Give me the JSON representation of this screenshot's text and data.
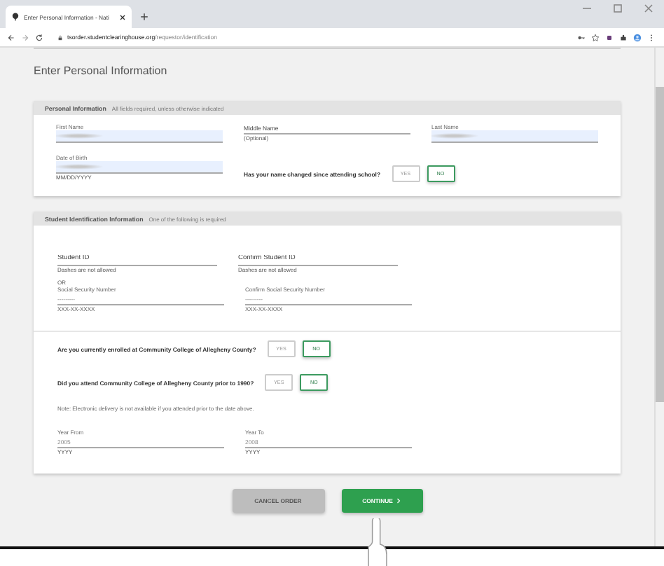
{
  "browser": {
    "tab_title": "Enter Personal Information - Nati",
    "url_host": "tsorder.studentclearinghouse.org",
    "url_path": "/requestor/identification"
  },
  "page_title": "Enter Personal Information",
  "personal": {
    "title": "Personal Information",
    "subtitle": "All fields required, unless otherwise indicated",
    "fields": [
      {
        "label": "First Name",
        "redacted": true
      },
      {
        "placeholder": "Middle Name",
        "hint": "(Optional)"
      },
      {
        "label": "Last Name",
        "redacted": true
      }
    ],
    "dob": {
      "label": "Date of Birth",
      "redacted": true,
      "hint": "MM/DD/YYYY"
    },
    "question": {
      "text": "Has your name changed since attending school?",
      "options": [
        {
          "label": "YES",
          "selected": false
        },
        {
          "label": "NO",
          "selected": true
        }
      ]
    }
  },
  "student": {
    "title": "Student Identification Information",
    "subtitle": "One of the following is required",
    "id_fields": [
      {
        "placeholder": "Student ID",
        "hint": "Dashes are not allowed"
      },
      {
        "placeholder": "Confirm Student ID",
        "hint": "Dashes are not allowed"
      }
    ],
    "or_text": "OR",
    "ssn_fields": [
      {
        "label": "Social Security Number",
        "value": "---------",
        "hint": "XXX-XX-XXXX"
      },
      {
        "label": "Confirm Social Security Number",
        "value": "---------",
        "hint": "XXX-XX-XXXX"
      }
    ],
    "questions": [
      {
        "text": "Are you currently enrolled at Community College of Allegheny County?",
        "options": [
          {
            "label": "YES",
            "selected": false
          },
          {
            "label": "NO",
            "selected": true
          }
        ]
      },
      {
        "text": "Did you attend Community College of Allegheny County prior to 1990?",
        "options": [
          {
            "label": "YES",
            "selected": false
          },
          {
            "label": "NO",
            "selected": true
          }
        ]
      }
    ],
    "note": "Note: Electronic delivery is not available if you attended prior to the date above.",
    "year_fields": [
      {
        "label": "Year From",
        "value": "2005",
        "hint": "YYYY"
      },
      {
        "label": "Year To",
        "value": "2008",
        "hint": "YYYY"
      }
    ]
  },
  "buttons": [
    {
      "label": "CANCEL ORDER",
      "kind": "secondary"
    },
    {
      "label": "CONTINUE",
      "kind": "primary"
    }
  ]
}
